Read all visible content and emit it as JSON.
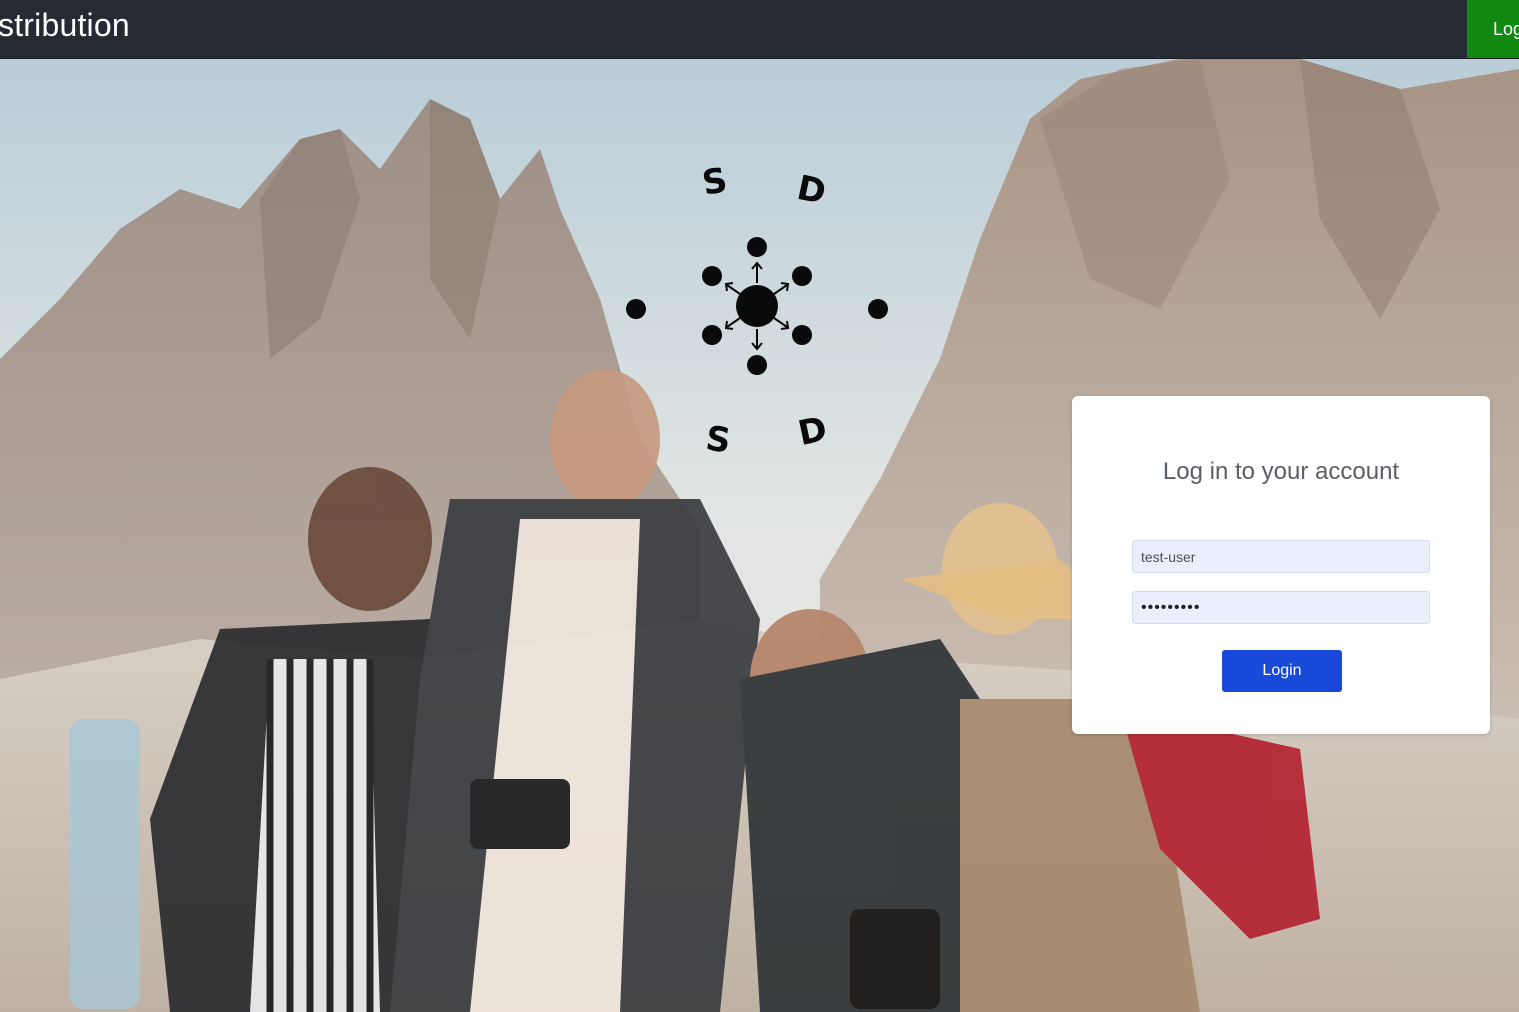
{
  "navbar": {
    "brand": "stribution",
    "login_label": "Log"
  },
  "hero": {
    "logo_letters": [
      "S",
      "D",
      "S",
      "D"
    ]
  },
  "login_card": {
    "title": "Log in to your account",
    "username_value": "test-user",
    "password_value": "•••••••••",
    "submit_label": "Login"
  },
  "colors": {
    "navbar_bg": "#252a33",
    "nav_login_bg": "#128a12",
    "primary_button": "#1849d8",
    "input_bg": "#e9effd"
  }
}
